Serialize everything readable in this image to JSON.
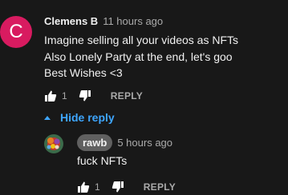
{
  "comment": {
    "avatar_letter": "C",
    "avatar_color": "#d81b60",
    "author": "Clemens B",
    "timestamp": "11 hours ago",
    "lines": [
      "Imagine selling all your videos as NFTs",
      "Also Lonely Party at the end, let's goo",
      "Best Wishes <3"
    ],
    "like_count": "1",
    "reply_label": "REPLY",
    "like_icon": "thumbs-up-icon",
    "dislike_icon": "thumbs-down-icon"
  },
  "hide_replies": {
    "label": "Hide reply",
    "icon": "caret-up-icon",
    "color": "#3ea6ff"
  },
  "reply": {
    "author": "rawb",
    "timestamp": "5 hours ago",
    "text": "fuck NFTs",
    "like_count": "1",
    "reply_label": "REPLY",
    "pill_color": "#606060"
  },
  "colors": {
    "background": "#181818",
    "text_primary": "#f1f1f1",
    "text_secondary": "#aaaaaa"
  }
}
